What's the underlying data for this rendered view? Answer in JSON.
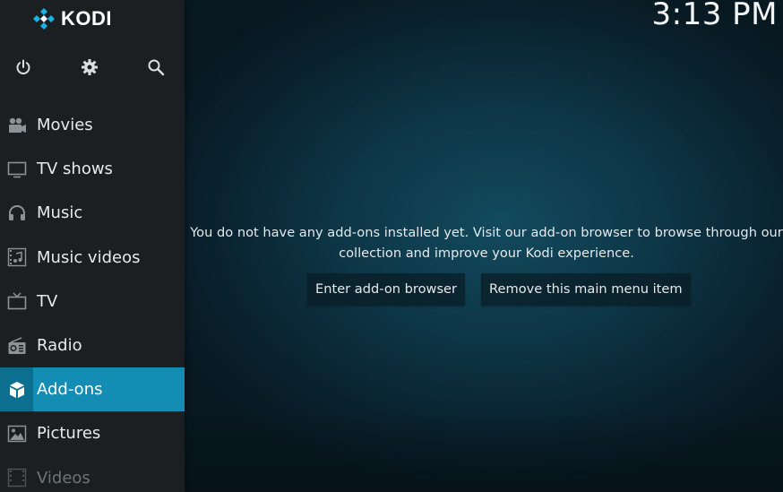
{
  "app": {
    "logo_text": "KODI",
    "clock": "3:13 PM"
  },
  "top_icons": [
    {
      "name": "power-icon"
    },
    {
      "name": "gear-icon"
    },
    {
      "name": "search-icon"
    }
  ],
  "menu": {
    "items": [
      {
        "label": "Movies",
        "icon": "movie-camera-icon"
      },
      {
        "label": "TV shows",
        "icon": "monitor-icon"
      },
      {
        "label": "Music",
        "icon": "headphones-icon"
      },
      {
        "label": "Music videos",
        "icon": "music-video-icon"
      },
      {
        "label": "TV",
        "icon": "tv-icon"
      },
      {
        "label": "Radio",
        "icon": "radio-icon"
      },
      {
        "label": "Add-ons",
        "icon": "addon-box-icon",
        "active": true
      },
      {
        "label": "Pictures",
        "icon": "picture-icon"
      },
      {
        "label": "Videos",
        "icon": "film-icon"
      }
    ]
  },
  "main": {
    "message_line1": "You do not have any add-ons installed yet. Visit our add-on browser to browse through our",
    "message_line2": "collection and improve your Kodi experience.",
    "enter_browser_label": "Enter add-on browser",
    "remove_item_label": "Remove this main menu item"
  },
  "colors": {
    "accent": "#148db5",
    "sidebar_bg": "#1b1f21",
    "background": "#0d3545"
  }
}
